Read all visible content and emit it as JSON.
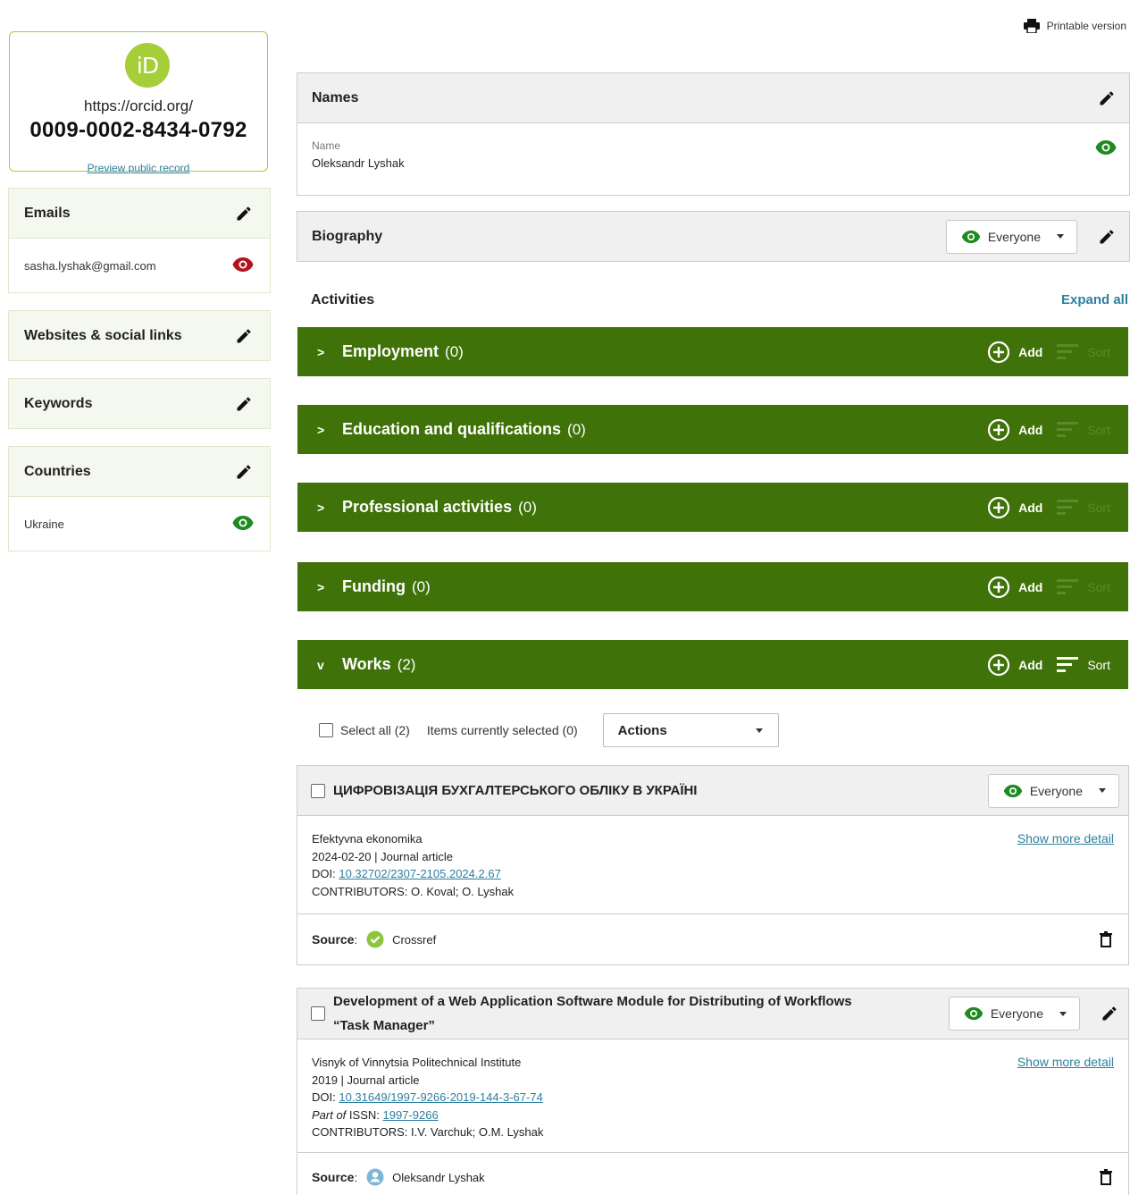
{
  "orcid": {
    "logo_text": "iD",
    "url_prefix": "https://orcid.org/",
    "id": "0009-0002-8434-0792",
    "preview_link": "Preview public record"
  },
  "sidebar": {
    "emails": {
      "label": "Emails",
      "value": "sasha.lyshak@gmail.com",
      "visibility": "private"
    },
    "websites": {
      "label": "Websites & social links"
    },
    "keywords": {
      "label": "Keywords"
    },
    "countries": {
      "label": "Countries",
      "value": "Ukraine",
      "visibility": "everyone"
    }
  },
  "header": {
    "printable": "Printable version"
  },
  "names": {
    "title": "Names",
    "field_label": "Name",
    "value": "Oleksandr Lyshak",
    "visibility": "everyone"
  },
  "biography": {
    "title": "Biography",
    "visibility_label": "Everyone"
  },
  "activities": {
    "label": "Activities",
    "expand_all": "Expand all",
    "add_label": "Add",
    "sort_label": "Sort",
    "sections": [
      {
        "title": "Employment",
        "count": "(0)",
        "chevron": ">"
      },
      {
        "title": "Education and qualifications",
        "count": "(0)",
        "chevron": ">"
      },
      {
        "title": "Professional activities",
        "count": "(0)",
        "chevron": ">"
      },
      {
        "title": "Funding",
        "count": "(0)",
        "chevron": ">"
      },
      {
        "title": "Works",
        "count": "(2)",
        "chevron": "v"
      }
    ]
  },
  "works_controls": {
    "select_all": "Select all (2)",
    "items_selected": "Items currently selected (0)",
    "actions": "Actions"
  },
  "works": [
    {
      "title": "ЦИФРОВІЗАЦІЯ БУХГАЛТЕРСЬКОГО ОБЛІКУ В УКРАЇНІ",
      "visibility": "Everyone",
      "journal": "Efektyvna ekonomika",
      "date_type": "2024-02-20 | Journal article",
      "doi_label": "DOI:",
      "doi": "10.32702/2307-2105.2024.2.67",
      "contributors": "CONTRIBUTORS: O. Koval; O. Lyshak",
      "show_more": "Show more detail",
      "source_label": "Source",
      "source": "Crossref"
    },
    {
      "title_line1": "Development of a Web Application Software Module for Distributing of Workflows",
      "title_line2": "“Task Manager”",
      "visibility": "Everyone",
      "journal": "Visnyk of Vinnytsia Politechnical Institute",
      "date_type": "2019 | Journal article",
      "doi_label": "DOI:",
      "doi": "10.31649/1997-9266-2019-144-3-67-74",
      "part_of": "Part of",
      "issn_label": "ISSN:",
      "issn": "1997-9266",
      "contributors": "CONTRIBUTORS: I.V. Varchuk; O.M. Lyshak",
      "show_more": "Show more detail",
      "source_label": "Source",
      "source": "Oleksandr Lyshak"
    }
  ],
  "colors": {
    "orcid_green": "#a6ce39",
    "activity_green": "#3f7208",
    "link_blue": "#2e7f9f",
    "eye_green": "#1f8a1f",
    "eye_red": "#b0151c"
  }
}
